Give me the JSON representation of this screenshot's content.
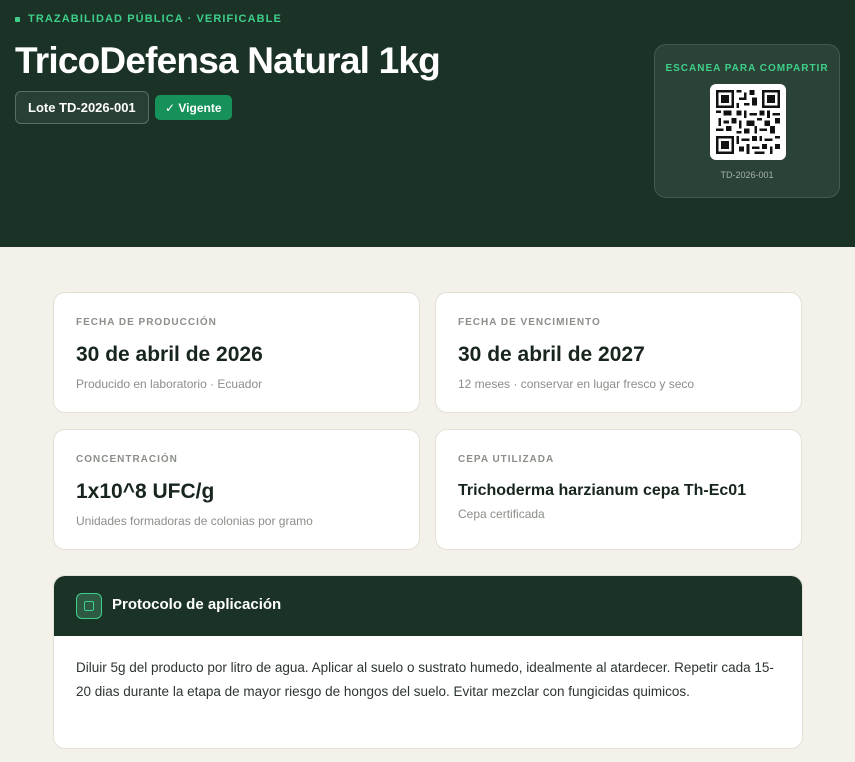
{
  "header": {
    "eyebrow": "TRAZABILIDAD PÚBLICA · VERIFICABLE",
    "title": "TricoDefensa Natural 1kg",
    "lote": "Lote TD-2026-001",
    "status": "✓ Vigente"
  },
  "qr": {
    "label": "ESCANEA PARA COMPARTIR",
    "code": "TD-2026-001"
  },
  "cards": [
    {
      "label": "FECHA DE PRODUCCIÓN",
      "value": "30 de abril de 2026",
      "sub": "Producido en laboratorio · Ecuador"
    },
    {
      "label": "FECHA DE VENCIMIENTO",
      "value": "30 de abril de 2027",
      "sub": "12 meses · conservar en lugar fresco y seco"
    },
    {
      "label": "CONCENTRACIÓN",
      "value": "1x10^8 UFC/g",
      "sub": "Unidades formadoras de colonias por gramo"
    },
    {
      "label": "CEPA UTILIZADA",
      "value": "Trichoderma harzianum cepa Th-Ec01",
      "sub": "Cepa certificada"
    }
  ],
  "protocol": {
    "title": "Protocolo de aplicación",
    "body": "Diluir 5g del producto por litro de agua. Aplicar al suelo o sustrato humedo, idealmente al atardecer. Repetir cada 15-20 dias durante la etapa de mayor riesgo de hongos del suelo. Evitar mezclar con fungicidas quimicos."
  },
  "colors": {
    "hero_bg": "#1b3327",
    "accent": "#3ecf8a",
    "status_bg": "#16915a",
    "page_bg": "#f3f1ea"
  },
  "icons": {
    "eyebrow": "square-dot-icon",
    "qr": "qr-code-icon",
    "protocol": "checkbox-icon"
  }
}
